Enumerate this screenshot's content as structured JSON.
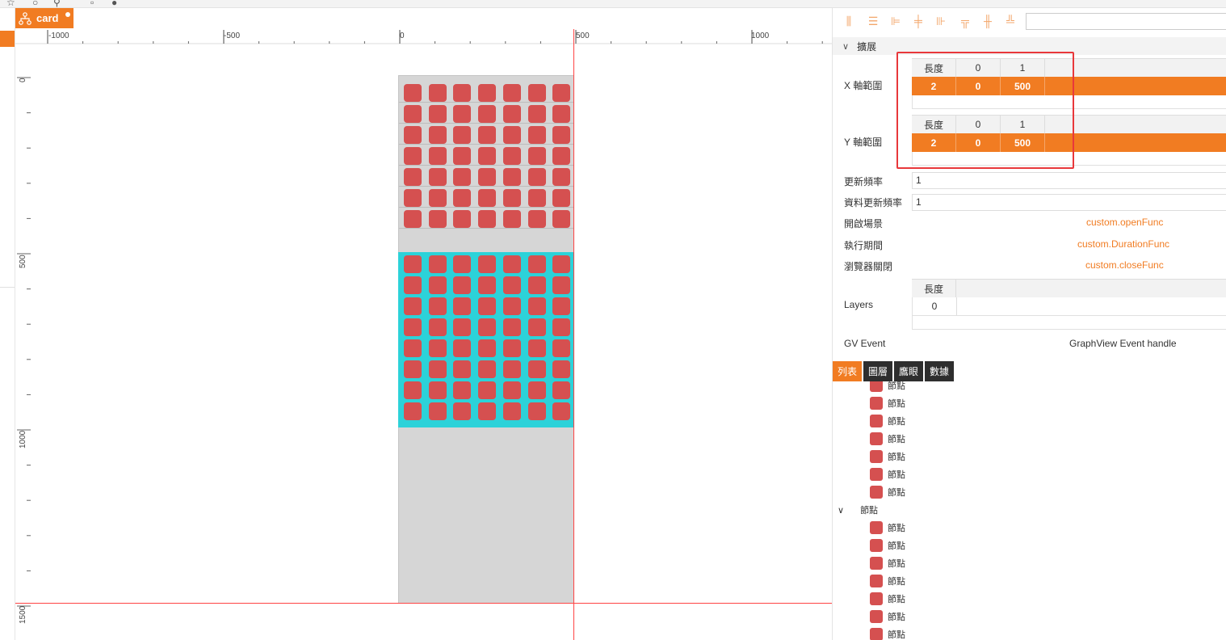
{
  "top_icons": [
    "star-icon",
    "circle-icon",
    "person-icon",
    "square-icon",
    "circle-filled-icon"
  ],
  "canvas": {
    "tab_label": "card",
    "ruler_h": [
      "-1000",
      "-500",
      "0",
      "500",
      "1000"
    ],
    "ruler_v": [
      "0",
      "500",
      "1000",
      "1500"
    ],
    "grid_cols": 7,
    "gray_rows": 7,
    "cyan_rows": 8,
    "colors": {
      "accent": "#f17c22",
      "node": "#d55050",
      "selected": "#2cd2d9",
      "guide": "#ff4444",
      "base": "#d6d6d6"
    }
  },
  "panel": {
    "toolbar_icons": [
      "align-left-edge-icon",
      "align-center-h-icon",
      "align-left-icon",
      "align-middle-icon",
      "align-right-icon",
      "align-top-icon",
      "distribute-v-icon",
      "align-bottom-icon"
    ],
    "section_title": "擴展",
    "x_range": {
      "label": "X 軸範圍",
      "header": [
        "長度",
        "0",
        "1"
      ],
      "values": [
        "2",
        "0",
        "500"
      ]
    },
    "y_range": {
      "label": "Y 軸範圍",
      "header": [
        "長度",
        "0",
        "1"
      ],
      "values": [
        "2",
        "0",
        "500"
      ]
    },
    "update_rate": {
      "label": "更新頻率",
      "value": "1"
    },
    "data_update_rate": {
      "label": "資料更新頻率",
      "value": "1"
    },
    "open_scene": {
      "label": "開啟場景",
      "value": "custom.openFunc"
    },
    "duration": {
      "label": "執行期間",
      "value": "custom.DurationFunc"
    },
    "browser_close": {
      "label": "瀏覽器關閉",
      "value": "custom.closeFunc"
    },
    "layers": {
      "label": "Layers",
      "header": "長度",
      "value": "0"
    },
    "gv_event": {
      "label": "GV Event",
      "value": "GraphView Event handle"
    },
    "tabs": [
      "列表",
      "圖層",
      "鷹眼",
      "數據"
    ],
    "tree": {
      "node_label": "節點",
      "group_label": "節點"
    }
  }
}
